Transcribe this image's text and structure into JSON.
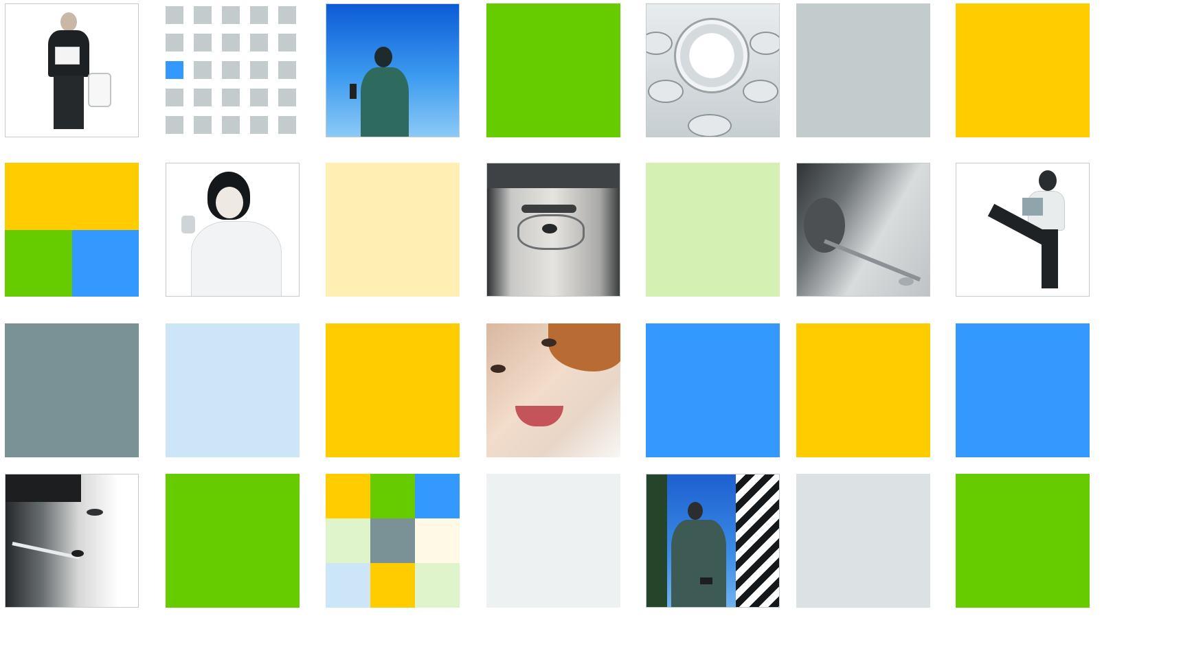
{
  "colors": {
    "green": "#66cc00",
    "yellow": "#ffcc00",
    "blue": "#3399ff",
    "grey": "#c4cbcd",
    "slate": "#7a9196",
    "pale_yellow": "#ffefb3",
    "pale_green": "#d4f0b3",
    "pale_blue": "#cce5f7",
    "pale_grey": "#eef1f2",
    "light_grey": "#dce2e4",
    "cream": "#fff9e6",
    "mint": "#e0f4cc"
  },
  "tiles": [
    {
      "row": 0,
      "col": 0,
      "kind": "photo",
      "subject": "businessman-holding-paper"
    },
    {
      "row": 0,
      "col": 1,
      "kind": "dot-grid",
      "highlight_index": 10
    },
    {
      "row": 0,
      "col": 2,
      "kind": "photo",
      "subject": "woman-on-phone-sky"
    },
    {
      "row": 0,
      "col": 3,
      "kind": "solid",
      "color": "green"
    },
    {
      "row": 0,
      "col": 4,
      "kind": "photo",
      "subject": "mobile-phone-keypad"
    },
    {
      "row": 0,
      "col": 5,
      "kind": "solid",
      "color": "grey"
    },
    {
      "row": 0,
      "col": 6,
      "kind": "solid",
      "color": "yellow"
    },
    {
      "row": 1,
      "col": 0,
      "kind": "split",
      "colors": [
        "yellow",
        "green",
        "blue"
      ]
    },
    {
      "row": 1,
      "col": 1,
      "kind": "photo",
      "subject": "woman-holding-phone"
    },
    {
      "row": 1,
      "col": 2,
      "kind": "solid",
      "color": "pale_yellow"
    },
    {
      "row": 1,
      "col": 3,
      "kind": "photo",
      "subject": "man-with-glasses-closeup"
    },
    {
      "row": 1,
      "col": 4,
      "kind": "solid",
      "color": "pale_green"
    },
    {
      "row": 1,
      "col": 5,
      "kind": "photo",
      "subject": "headset-closeup"
    },
    {
      "row": 1,
      "col": 6,
      "kind": "photo",
      "subject": "woman-striding-with-folder"
    },
    {
      "row": 2,
      "col": 0,
      "kind": "solid",
      "color": "slate"
    },
    {
      "row": 2,
      "col": 1,
      "kind": "solid",
      "color": "pale_blue"
    },
    {
      "row": 2,
      "col": 2,
      "kind": "solid",
      "color": "yellow"
    },
    {
      "row": 2,
      "col": 3,
      "kind": "photo",
      "subject": "smiling-woman-closeup"
    },
    {
      "row": 2,
      "col": 4,
      "kind": "solid",
      "color": "blue"
    },
    {
      "row": 2,
      "col": 5,
      "kind": "solid",
      "color": "yellow"
    },
    {
      "row": 2,
      "col": 6,
      "kind": "solid",
      "color": "blue"
    },
    {
      "row": 3,
      "col": 0,
      "kind": "photo",
      "subject": "man-with-headset-profile"
    },
    {
      "row": 3,
      "col": 1,
      "kind": "solid",
      "color": "green"
    },
    {
      "row": 3,
      "col": 2,
      "kind": "mosaic",
      "colors": [
        "yellow",
        "green",
        "blue",
        "mint",
        "slate",
        "cream",
        "pale_blue",
        "yellow",
        "mint"
      ]
    },
    {
      "row": 3,
      "col": 3,
      "kind": "solid",
      "color": "pale_grey"
    },
    {
      "row": 3,
      "col": 4,
      "kind": "photo",
      "subject": "man-with-phone-building"
    },
    {
      "row": 3,
      "col": 5,
      "kind": "solid",
      "color": "light_grey"
    },
    {
      "row": 3,
      "col": 6,
      "kind": "solid",
      "color": "green"
    }
  ]
}
